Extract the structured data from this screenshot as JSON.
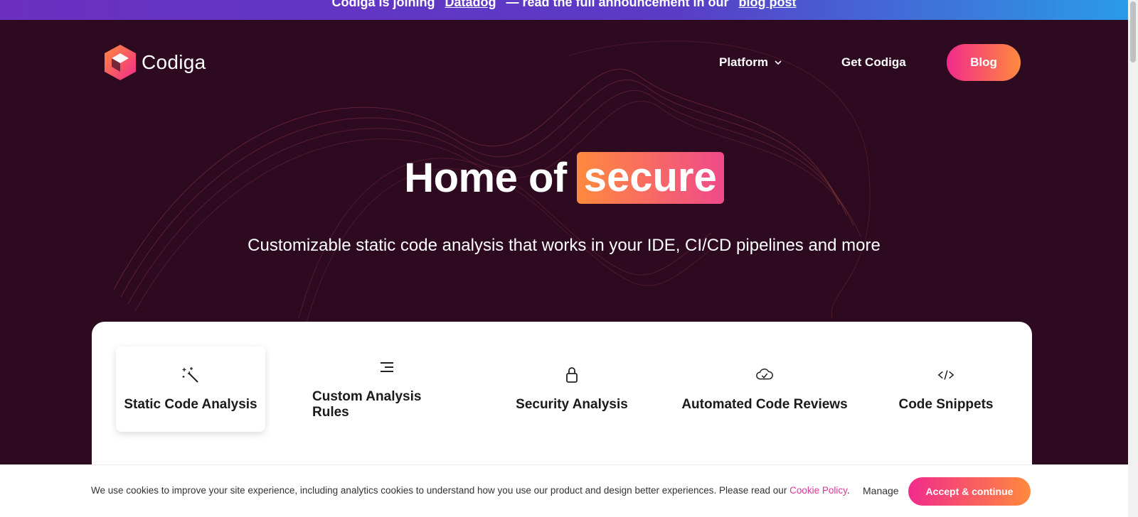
{
  "announcement": {
    "text_start": "Codiga is joining",
    "link1": "Datadog",
    "text_mid": "— read the full announcement in our",
    "link2": "blog post"
  },
  "brand": {
    "name": "Codiga"
  },
  "nav": {
    "platform": "Platform",
    "get": "Get Codiga",
    "blog": "Blog"
  },
  "hero": {
    "title_prefix": "Home of",
    "title_highlight": "secure",
    "subtitle": "Customizable static code analysis that works in your IDE, CI/CD pipelines and more"
  },
  "tabs": [
    {
      "label": "Static Code Analysis",
      "icon": "magic-wand-icon",
      "active": true
    },
    {
      "label": "Custom Analysis Rules",
      "icon": "align-lines-icon",
      "active": false
    },
    {
      "label": "Security Analysis",
      "icon": "lock-icon",
      "active": false
    },
    {
      "label": "Automated Code Reviews",
      "icon": "cloud-check-icon",
      "active": false
    },
    {
      "label": "Code Snippets",
      "icon": "code-icon",
      "active": false
    }
  ],
  "cookie": {
    "message": "We use cookies to improve your site experience, including analytics cookies to understand how you use our product and design better experiences. Please read our ",
    "policy_link": "Cookie Policy",
    "period": ".",
    "manage": "Manage",
    "accept": "Accept & continue"
  },
  "colors": {
    "background": "#2e0a20",
    "accent_pink": "#f22a8c",
    "accent_orange": "#ff8a3d"
  }
}
